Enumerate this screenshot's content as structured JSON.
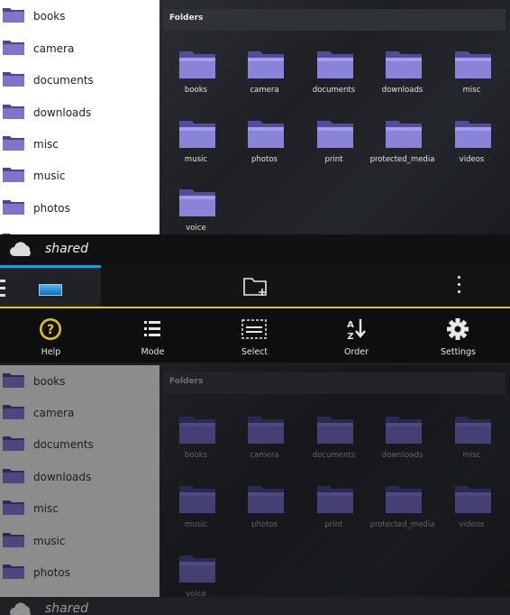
{
  "sidebar": {
    "items": [
      {
        "label": "books"
      },
      {
        "label": "camera"
      },
      {
        "label": "documents"
      },
      {
        "label": "downloads"
      },
      {
        "label": "misc"
      },
      {
        "label": "music"
      },
      {
        "label": "photos"
      }
    ]
  },
  "content": {
    "section_title": "Folders",
    "folders": [
      {
        "label": "books"
      },
      {
        "label": "camera"
      },
      {
        "label": "documents"
      },
      {
        "label": "downloads"
      },
      {
        "label": "misc"
      },
      {
        "label": "music"
      },
      {
        "label": "photos"
      },
      {
        "label": "print"
      },
      {
        "label": "protected_media"
      },
      {
        "label": "videos"
      },
      {
        "label": "voice"
      }
    ]
  },
  "location": {
    "label": "shared"
  },
  "actions": [
    {
      "label": "Help",
      "icon": "help-icon"
    },
    {
      "label": "Mode",
      "icon": "list-icon"
    },
    {
      "label": "Select",
      "icon": "select-icon"
    },
    {
      "label": "Order",
      "icon": "sort-az-icon"
    },
    {
      "label": "Settings",
      "icon": "gear-icon"
    }
  ],
  "colors": {
    "accent_blue": "#1e9ad6",
    "accent_yellow": "#e5c41b",
    "folder_purple": "#8a84d8"
  }
}
